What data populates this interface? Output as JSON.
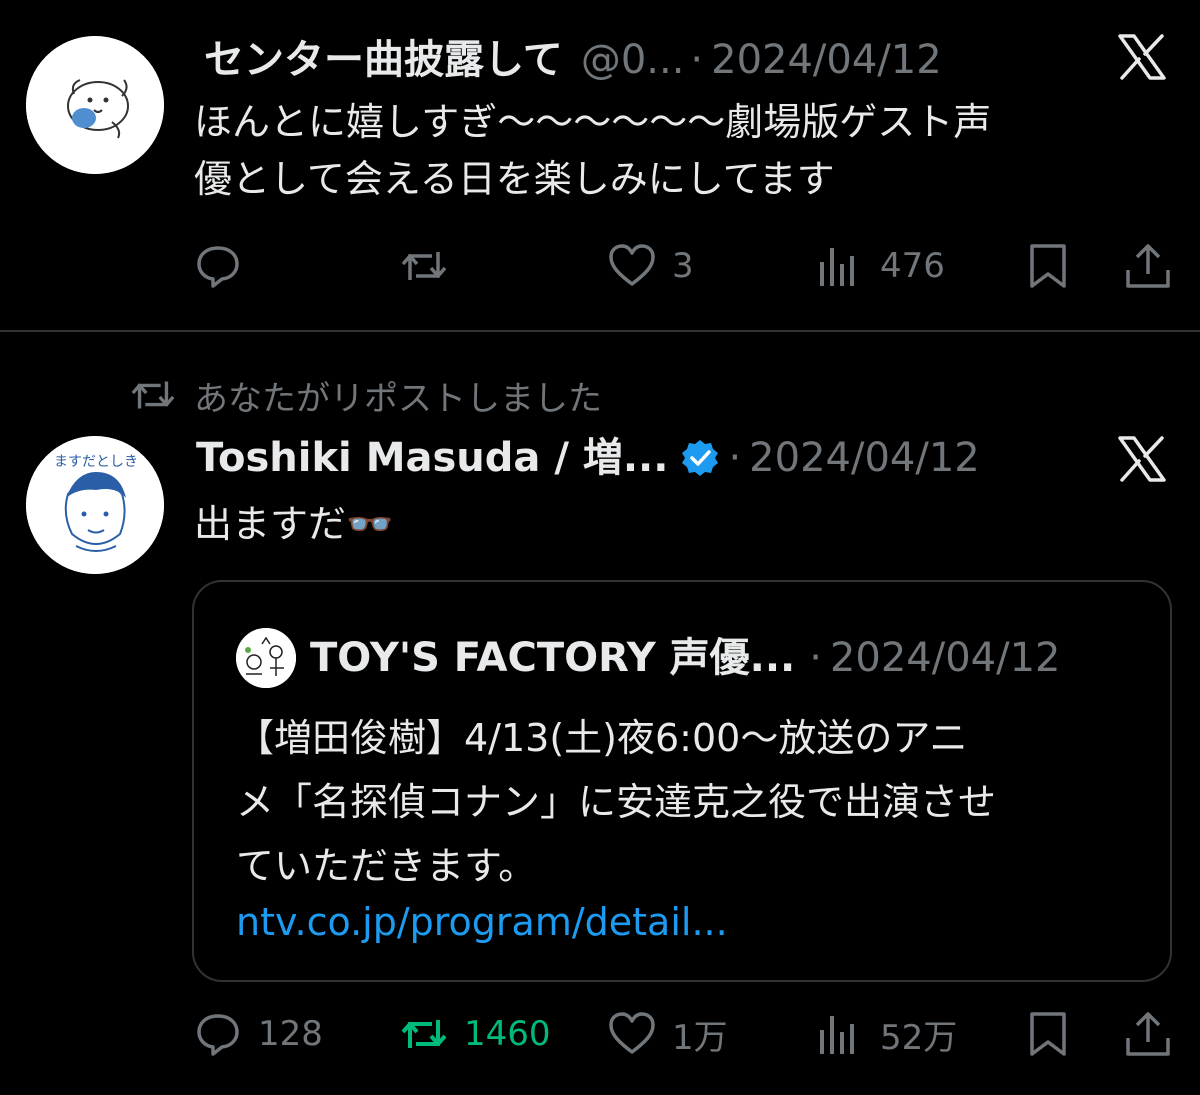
{
  "tweets": [
    {
      "name": "センター曲披露して",
      "handle": "@0...",
      "separator": "·",
      "date": "2024/04/12",
      "text_lines": [
        "ほんとに嬉しすぎ〜〜〜〜〜〜劇場版ゲスト声",
        "優として会える日を楽しみにしてます"
      ],
      "actions": {
        "reply": "",
        "repost": "",
        "like": "3",
        "views": "476"
      }
    },
    {
      "repost_note": "あなたがリポストしました",
      "name": "Toshiki Masuda / 増...",
      "verified": true,
      "separator": "·",
      "date": "2024/04/12",
      "text": "出ますだ👓",
      "avatar_text": "ますだとしき",
      "quote": {
        "name": "TOY'S FACTORY 声優...",
        "separator": "·",
        "date": "2024/04/12",
        "text_lines": [
          "【増田俊樹】4/13(土)夜6:00〜放送のアニ",
          "メ「名探偵コナン」に安達克之役で出演させ",
          "ていただきます。"
        ],
        "link": "ntv.co.jp/program/detail..."
      },
      "actions": {
        "reply": "128",
        "repost": "1460",
        "like": "1万",
        "views": "52万"
      }
    }
  ],
  "icons": [
    "reply-icon",
    "repost-icon",
    "like-icon",
    "views-icon",
    "bookmark-icon",
    "share-icon",
    "x-logo-icon",
    "verified-badge-icon"
  ],
  "colors": {
    "background": "#000000",
    "text": "#e7e9ea",
    "secondary": "#71767b",
    "link": "#1d9bf0",
    "repost_active": "#00ba7c",
    "verified": "#1d9bf0",
    "divider": "#2f3336"
  }
}
